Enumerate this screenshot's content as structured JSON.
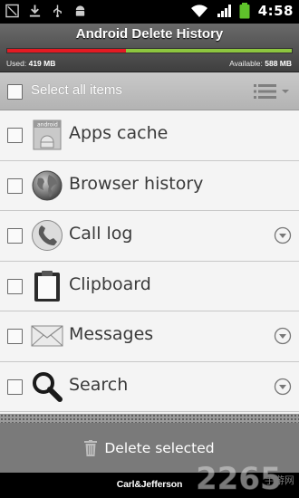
{
  "status_bar": {
    "time": "4:58",
    "icons": [
      "usb-debug-icon",
      "download-icon",
      "usb-icon",
      "android-icon",
      "wifi-icon",
      "signal-icon",
      "battery-icon"
    ]
  },
  "header": {
    "title": "Android Delete History",
    "used_label": "Used:",
    "used_value": "419 MB",
    "available_label": "Available:",
    "available_value": "588 MB",
    "used_fraction": 0.416,
    "colors": {
      "used": "#e31b23",
      "available": "#8dc63f"
    }
  },
  "select_all": {
    "label": "Select all items",
    "checked": false
  },
  "items": [
    {
      "label": "Apps cache",
      "icon": "android-box-icon",
      "checked": false,
      "expandable": false
    },
    {
      "label": "Browser history",
      "icon": "globe-icon",
      "checked": false,
      "expandable": false
    },
    {
      "label": "Call log",
      "icon": "phone-icon",
      "checked": false,
      "expandable": true
    },
    {
      "label": "Clipboard",
      "icon": "clipboard-icon",
      "checked": false,
      "expandable": false
    },
    {
      "label": "Messages",
      "icon": "envelope-icon",
      "checked": false,
      "expandable": true
    },
    {
      "label": "Search",
      "icon": "magnifier-icon",
      "checked": false,
      "expandable": true
    }
  ],
  "footer": {
    "delete_label": "Delete selected",
    "brand": "Carl&Jefferson"
  },
  "watermark": {
    "text": "2265",
    "sub": "手游网"
  }
}
